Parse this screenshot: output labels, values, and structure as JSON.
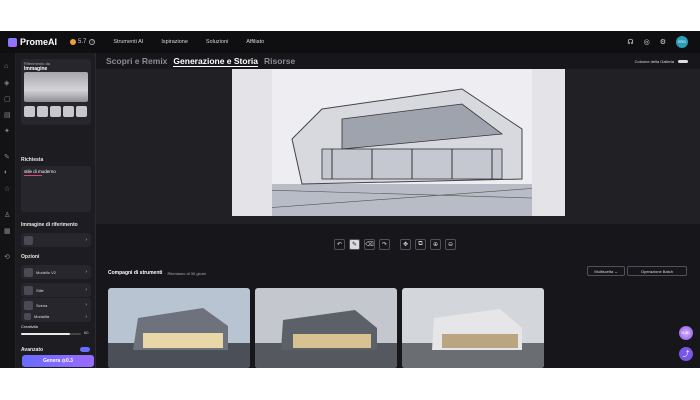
{
  "brand": "PromeAI",
  "credits": "5.7",
  "nav": [
    "Strumenti AI",
    "Ispirazione",
    "Soluzioni",
    "Affiliato"
  ],
  "user": {
    "initials": "ERG"
  },
  "sidebar": {
    "ref_subtitle": "Riferimento da",
    "ref_title": "Immagine",
    "prompt_label": "Richiesta",
    "prompt_value": "stile di moderno",
    "ref_image_label": "Immagine di riferimento",
    "options_label": "Opzioni",
    "model_sub": "Modello",
    "model_name": "V2",
    "style_label": "Stile",
    "scene_label": "Scena",
    "mode_label": "Modalità",
    "creativity_label": "Creatività",
    "creativity_value": "60",
    "advanced_label": "Avanzato",
    "generate_label": "Genera",
    "generate_cost": "0.3",
    "creativity_fraction": 0.82
  },
  "tabs": [
    "Scopri e Remix",
    "Generazione e Storia",
    "Risorse"
  ],
  "active_tab": 1,
  "gallery_columns_label": "Colonne della Galleria",
  "tools_header": "Compagni di strumenti",
  "tools_sub": "Riteniamo di 30 giorni",
  "multi_select": "Multiscelta",
  "batch_op": "Operazione Batch",
  "float_badge": "11:30"
}
